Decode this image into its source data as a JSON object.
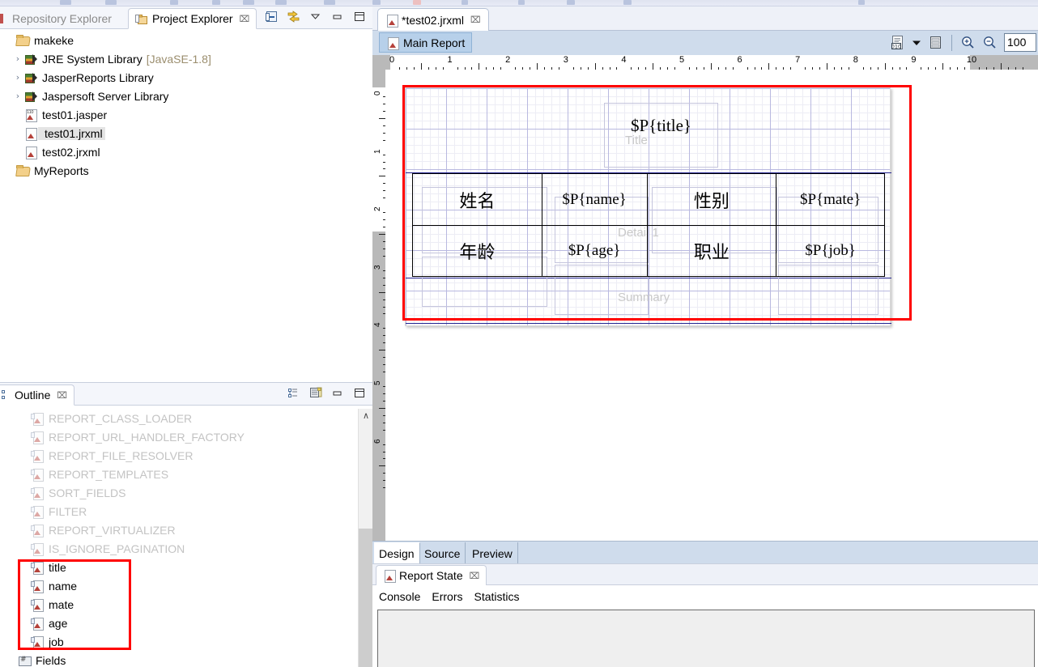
{
  "app": {
    "window_title": "JasperSoft Studio"
  },
  "left_panel": {
    "tabs": [
      {
        "label": "Repository Explorer",
        "icon": "repository-icon",
        "active": false
      },
      {
        "label": "Project Explorer",
        "icon": "project-folder-icon",
        "active": true,
        "close": "⌧"
      }
    ],
    "toolbar_icons": [
      "collapse-all-icon",
      "link-with-editor-icon",
      "view-menu-chevron-icon",
      "minimize-icon",
      "maximize-icon"
    ],
    "tree": [
      {
        "label": "makeke",
        "icon": "folder-icon",
        "arrow": "",
        "indent": 0,
        "selected": false
      },
      {
        "label": "JRE System Library",
        "sub": "[JavaSE-1.8]",
        "icon": "library-icon",
        "arrow": "›",
        "indent": 1,
        "selected": false
      },
      {
        "label": "JasperReports Library",
        "icon": "library-icon",
        "arrow": "›",
        "indent": 1,
        "selected": false
      },
      {
        "label": "Jaspersoft Server Library",
        "icon": "library-icon",
        "arrow": "›",
        "indent": 1,
        "selected": false
      },
      {
        "label": "test01.jasper",
        "icon": "jasper-file-icon",
        "arrow": "",
        "indent": 1,
        "selected": false
      },
      {
        "label": "test01.jrxml",
        "icon": "jrxml-file-icon",
        "arrow": "",
        "indent": 1,
        "selected": true
      },
      {
        "label": "test02.jrxml",
        "icon": "jrxml-file-icon",
        "arrow": "",
        "indent": 1,
        "selected": false
      },
      {
        "label": "MyReports",
        "icon": "folder-icon",
        "arrow": "",
        "indent": 0,
        "selected": false
      }
    ]
  },
  "outline_panel": {
    "tab": {
      "label": "Outline",
      "icon": "outline-icon",
      "close": "⌧"
    },
    "toolbar_icons": [
      "tree-view-icon",
      "report-outline-icon",
      "minimize-icon",
      "maximize-icon"
    ],
    "items": [
      {
        "label": "REPORT_CLASS_LOADER",
        "dim": true
      },
      {
        "label": "REPORT_URL_HANDLER_FACTORY",
        "dim": true
      },
      {
        "label": "REPORT_FILE_RESOLVER",
        "dim": true
      },
      {
        "label": "REPORT_TEMPLATES",
        "dim": true
      },
      {
        "label": "SORT_FIELDS",
        "dim": true
      },
      {
        "label": "FILTER",
        "dim": true
      },
      {
        "label": "REPORT_VIRTUALIZER",
        "dim": true
      },
      {
        "label": "IS_IGNORE_PAGINATION",
        "dim": true
      },
      {
        "label": "title",
        "dim": false
      },
      {
        "label": "name",
        "dim": false
      },
      {
        "label": "mate",
        "dim": false
      },
      {
        "label": "age",
        "dim": false
      },
      {
        "label": "job",
        "dim": false
      }
    ],
    "fields_node": {
      "label": "Fields",
      "icon": "fields-icon"
    },
    "scrollbar": {
      "arrow_up": "∧"
    }
  },
  "editor": {
    "tab": {
      "label": "*test02.jrxml",
      "icon": "jrxml-file-icon",
      "close": "⌧"
    },
    "toolbar": {
      "main_report_label": "Main Report",
      "main_report_icon": "report-icon",
      "dataset_icon": "dataset-icon",
      "dropdown_icon": "chevron-down-icon",
      "list_icon": "list-icon",
      "zoom_in_icon": "zoom-in-icon",
      "zoom_out_icon": "zoom-out-icon",
      "zoom_value": "100"
    },
    "ruler_h": {
      "labels": [
        "0",
        "1",
        "2",
        "3",
        "4",
        "5",
        "6",
        "7",
        "8",
        "9",
        "10"
      ]
    },
    "ruler_v": {
      "labels": [
        "0",
        "1",
        "2",
        "3",
        "4",
        "5",
        "6"
      ]
    },
    "bottom_tabs": [
      {
        "label": "Design",
        "active": true
      },
      {
        "label": "Source",
        "active": false
      },
      {
        "label": "Preview",
        "active": false
      }
    ]
  },
  "report_design": {
    "bands": [
      {
        "name": "Title"
      },
      {
        "name": "Detail 1"
      },
      {
        "name": "Summary"
      }
    ],
    "title_field": "$P{title}",
    "table_rows": [
      [
        {
          "text": "姓名",
          "cjk": true
        },
        {
          "text": "$P{name}",
          "cjk": false
        },
        {
          "text": "性别",
          "cjk": true
        },
        {
          "text": "$P{mate}",
          "cjk": false
        }
      ],
      [
        {
          "text": "年龄",
          "cjk": true
        },
        {
          "text": "$P{age}",
          "cjk": false
        },
        {
          "text": "职业",
          "cjk": true
        },
        {
          "text": "$P{job}",
          "cjk": false
        }
      ]
    ]
  },
  "report_state": {
    "tab": {
      "label": "Report State",
      "icon": "report-state-icon",
      "close": "⌧"
    },
    "subtabs": [
      {
        "label": "Console"
      },
      {
        "label": "Errors"
      },
      {
        "label": "Statistics"
      }
    ]
  },
  "annotations": {
    "highlight_color": "#ff0000",
    "boxes": [
      "report-canvas-highlight",
      "outline-parameters-highlight"
    ]
  }
}
